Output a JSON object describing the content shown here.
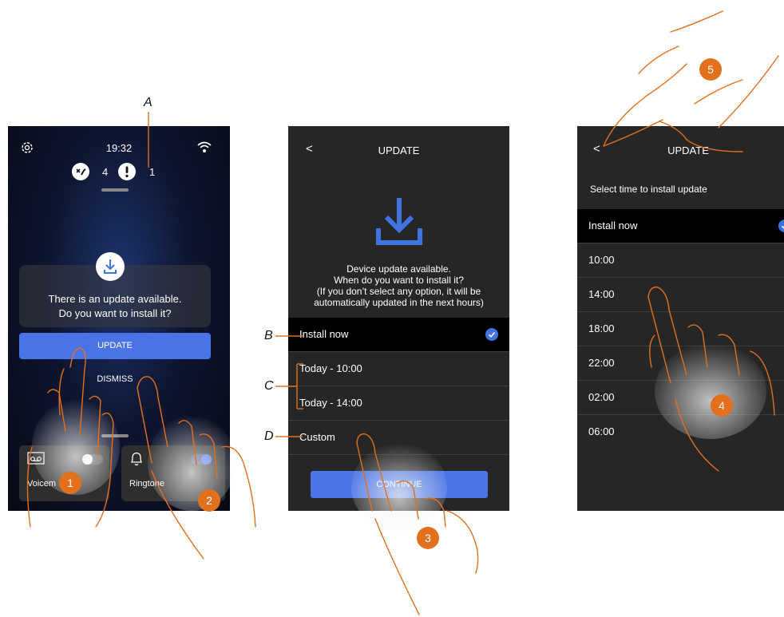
{
  "labels": {
    "a": "A",
    "b": "B",
    "c": "C",
    "d": "D"
  },
  "steps": [
    "1",
    "2",
    "3",
    "4",
    "5"
  ],
  "screen1": {
    "time": "19:32",
    "missed_count": "4",
    "alert_count": "1",
    "message_line1": "There is an update available.",
    "message_line2": "Do you want to install it?",
    "update_label": "UPDATE",
    "dismiss_label": "DISMISS",
    "tile_voicemail": "Voicem",
    "tile_ringtone": "Ringtone"
  },
  "screen2": {
    "back": "<",
    "title": "UPDATE",
    "info_line1": "Device update available.",
    "info_line2": "When do you want to install it?",
    "info_line3": "(If you don’t select any option, it will be",
    "info_line4": "automatically updated in the next hours)",
    "options": [
      "Install now",
      "Today - 10:00",
      "Today - 14:00",
      "Custom"
    ],
    "continue_label": "CONTINUE"
  },
  "screen3": {
    "back": "<",
    "title": "UPDATE",
    "subtitle": "Select time to install update",
    "options": [
      "Install now",
      "10:00",
      "14:00",
      "18:00",
      "22:00",
      "02:00",
      "06:00"
    ]
  },
  "colors": {
    "accent": "#3f73e0",
    "badge": "#e3701d",
    "screen_bg": "#262626"
  }
}
